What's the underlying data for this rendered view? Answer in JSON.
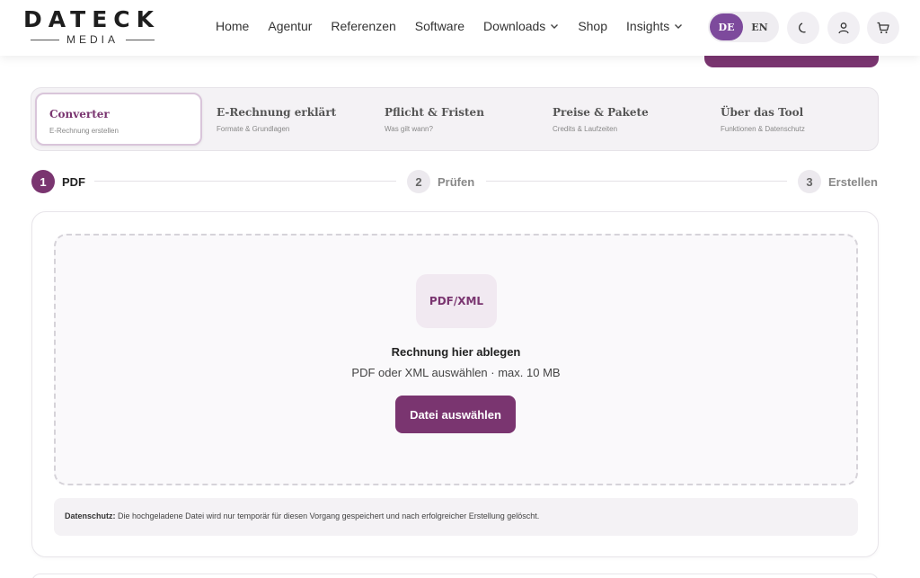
{
  "brand": {
    "name": "DATECK",
    "sub": "MEDIA"
  },
  "nav": {
    "items": [
      {
        "label": "Home",
        "dropdown": false
      },
      {
        "label": "Agentur",
        "dropdown": false
      },
      {
        "label": "Referenzen",
        "dropdown": false
      },
      {
        "label": "Software",
        "dropdown": false
      },
      {
        "label": "Downloads",
        "dropdown": true
      },
      {
        "label": "Shop",
        "dropdown": false
      },
      {
        "label": "Insights",
        "dropdown": true
      }
    ]
  },
  "lang": {
    "active": "DE",
    "other": "EN"
  },
  "icons": {
    "theme": "moon-icon",
    "account": "user-icon",
    "cart": "cart-icon"
  },
  "tabs": [
    {
      "title": "Converter",
      "sub": "E-Rechnung erstellen",
      "active": true
    },
    {
      "title": "E-Rechnung erklärt",
      "sub": "Formate & Grundlagen",
      "active": false
    },
    {
      "title": "Pflicht & Fristen",
      "sub": "Was gilt wann?",
      "active": false
    },
    {
      "title": "Preise & Pakete",
      "sub": "Credits & Laufzeiten",
      "active": false
    },
    {
      "title": "Über das Tool",
      "sub": "Funktionen & Datenschutz",
      "active": false
    }
  ],
  "steps": [
    {
      "num": "1",
      "label": "PDF",
      "active": true
    },
    {
      "num": "2",
      "label": "Prüfen",
      "active": false
    },
    {
      "num": "3",
      "label": "Erstellen",
      "active": false
    }
  ],
  "upload": {
    "badge": "PDF/XML",
    "title": "Rechnung hier ablegen",
    "subtitle": "PDF oder XML auswählen · max. 10 MB",
    "button": "Datei auswählen"
  },
  "privacy": {
    "label": "Datenschutz:",
    "text": " Die hochgeladene Datei wird nur temporär für diesen Vorgang gespeichert und nach erfolgreicher Erstellung gelöscht."
  },
  "colors": {
    "accent": "#7a3570",
    "lang_active": "#7d4a9c",
    "tab_bg": "#f4f2f5"
  }
}
